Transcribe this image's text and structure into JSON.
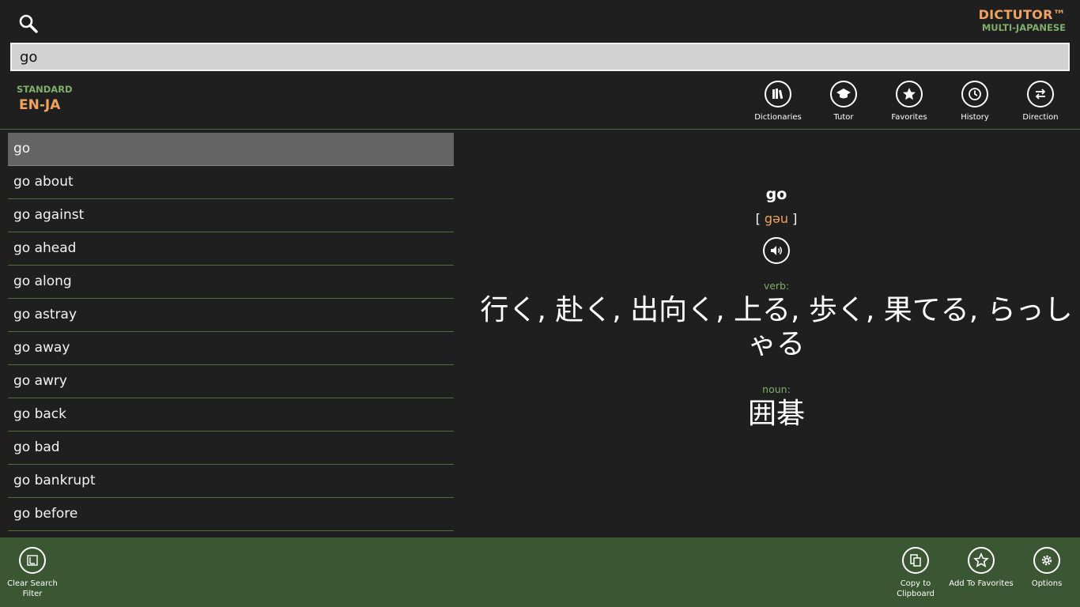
{
  "brand": {
    "title": "DICTUTOR™",
    "subtitle": "MULTI-JAPANESE"
  },
  "search": {
    "value": "go"
  },
  "dictionary_mode": {
    "label": "STANDARD",
    "value": "EN-JA"
  },
  "toolbar": {
    "dictionaries": "Dictionaries",
    "tutor": "Tutor",
    "favorites": "Favorites",
    "history": "History",
    "direction": "Direction"
  },
  "word_list": [
    "go",
    "go about",
    "go against",
    "go ahead",
    "go along",
    "go astray",
    "go away",
    "go awry",
    "go back",
    "go bad",
    "go bankrupt",
    "go before"
  ],
  "detail": {
    "headword": "go",
    "pron_open": "[",
    "pronunciation": "gəu",
    "pron_close": "]",
    "senses": [
      {
        "pos": "verb:",
        "meaning": "行く, 赴く, 出向く, 上る, 歩く, 果てる, らっしゃる"
      },
      {
        "pos": "noun:",
        "meaning": "囲碁"
      }
    ]
  },
  "appbar": {
    "clear_filter": "Clear Search Filter",
    "copy": "Copy to Clipboard",
    "add_favorites": "Add To Favorites",
    "options": "Options"
  }
}
